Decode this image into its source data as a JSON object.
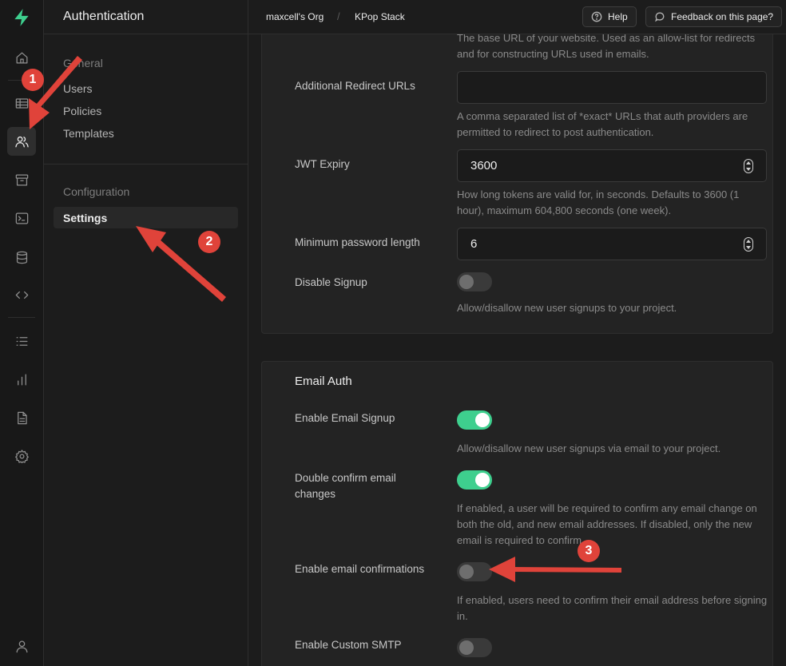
{
  "colors": {
    "brand": "#3ecf8e",
    "annotation": "#e0433a"
  },
  "rail": {
    "icons": [
      "supabase-logo-icon",
      "home-icon",
      "table-editor-icon",
      "users-icon",
      "storage-icon",
      "terminal-icon",
      "database-icon",
      "code-icon",
      "list-icon",
      "reports-icon",
      "docs-icon",
      "settings-icon",
      "account-icon"
    ]
  },
  "sidebar": {
    "title": "Authentication",
    "general_title": "General",
    "general_items": [
      "Users",
      "Policies",
      "Templates"
    ],
    "configuration_title": "Configuration",
    "configuration_items": [
      "Settings"
    ]
  },
  "topbar": {
    "org": "maxcell's Org",
    "separator": "/",
    "project": "KPop Stack",
    "help_label": "Help",
    "feedback_label": "Feedback on this page?"
  },
  "general_settings": {
    "site_url_help": "The base URL of your website. Used as an allow-list for redirects and for constructing URLs used in emails.",
    "redirect_label": "Additional Redirect URLs",
    "redirect_value": "",
    "redirect_help": "A comma separated list of *exact* URLs that auth providers are permitted to redirect to post authentication.",
    "jwt_label": "JWT Expiry",
    "jwt_value": "3600",
    "jwt_help": "How long tokens are valid for, in seconds. Defaults to 3600 (1 hour), maximum 604,800 seconds (one week).",
    "minpw_label": "Minimum password length",
    "minpw_value": "6",
    "signup_label": "Disable Signup",
    "signup_help": "Allow/disallow new user signups to your project."
  },
  "email_auth": {
    "title": "Email Auth",
    "enable_signup_label": "Enable Email Signup",
    "enable_signup_help": "Allow/disallow new user signups via email to your project.",
    "double_confirm_label": "Double confirm email changes",
    "double_confirm_help": "If enabled, a user will be required to confirm any email change on both the old, and new email addresses. If disabled, only the new email is required to confirm",
    "confirmations_label": "Enable email confirmations",
    "confirmations_help": "If enabled, users need to confirm their email address before signing in.",
    "smtp_label": "Enable Custom SMTP"
  },
  "annotations": {
    "badge_1": "1",
    "badge_2": "2",
    "badge_3": "3"
  }
}
